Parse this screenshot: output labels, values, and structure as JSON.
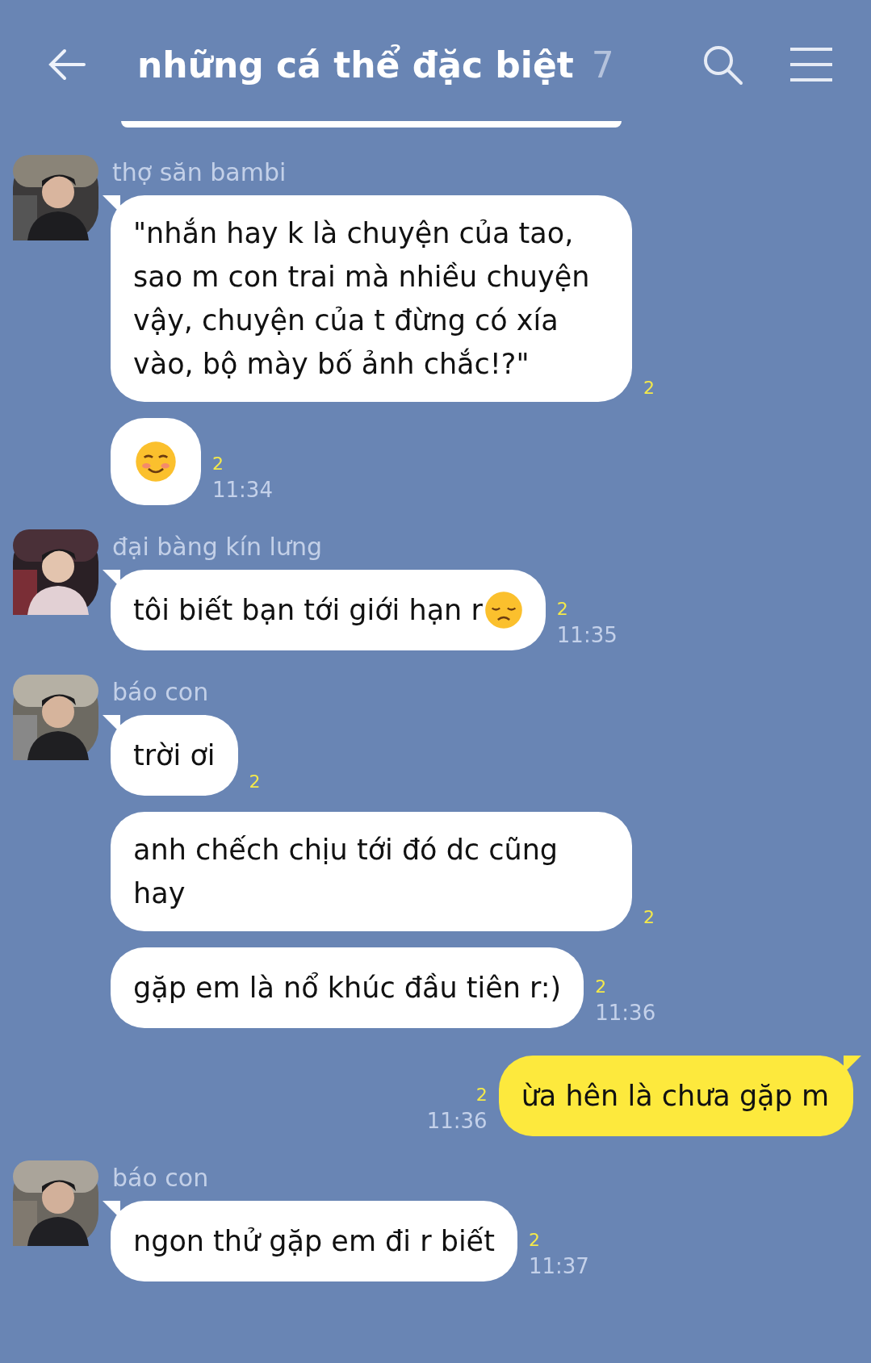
{
  "header": {
    "title": "những cá thể đặc biệt",
    "member_count": "7"
  },
  "messages": [
    {
      "kind": "incoming",
      "sender": "thợ săn bambi",
      "avatar": {
        "kind": "picture"
      },
      "bubbles": [
        {
          "kind": "text",
          "text": "\"nhắn hay k là chuyện của tao, sao m con trai mà nhiều chuyện vậy, chuyện của t đừng có xía vào, bộ mày bố ảnh chắc!?\"",
          "read": "2"
        },
        {
          "kind": "smiling_emoji",
          "read": "2",
          "time": "11:34"
        }
      ]
    },
    {
      "kind": "incoming",
      "sender": "đại bàng kín lưng",
      "avatar": {
        "kind": "picture"
      },
      "bubbles": [
        {
          "kind": "text_with_sad_emoji",
          "text": "tôi biết bạn tới giới hạn r",
          "read": "2",
          "time": "11:35"
        }
      ]
    },
    {
      "kind": "incoming",
      "sender": "báo con",
      "avatar": {
        "kind": "picture"
      },
      "bubbles": [
        {
          "text": "trời ơi",
          "read": "2"
        },
        {
          "text": "anh chếch chịu tới đó dc cũng hay",
          "read": "2"
        },
        {
          "text": "gặp em là nổ khúc đầu tiên r:)",
          "read": "2",
          "time": "11:36"
        }
      ]
    },
    {
      "kind": "outgoing",
      "bubbles": [
        {
          "text": "ừa hên là chưa gặp m",
          "read": "2",
          "time": "11:36"
        }
      ]
    },
    {
      "kind": "incoming",
      "sender": "báo con",
      "avatar": {
        "kind": "picture"
      },
      "bubbles": [
        {
          "text": "ngon thử gặp em đi r biết",
          "read": "2",
          "time": "11:37"
        }
      ]
    }
  ]
}
